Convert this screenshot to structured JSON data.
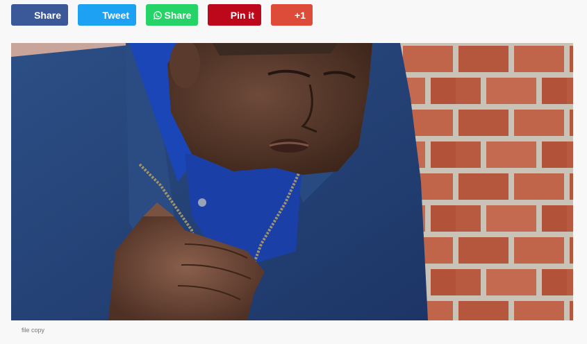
{
  "share_bar": {
    "facebook": {
      "label": "Share",
      "color": "#3b5998"
    },
    "twitter": {
      "label": "Tweet",
      "color": "#1da1f2"
    },
    "whatsapp": {
      "label": "Share",
      "color": "#25d366",
      "icon": "whatsapp-icon"
    },
    "pinterest": {
      "label": "Pin it",
      "color": "#bd081c"
    },
    "googleplus": {
      "label": "+1",
      "color": "#dd4b39"
    }
  },
  "photo": {
    "caption": "file copy"
  }
}
